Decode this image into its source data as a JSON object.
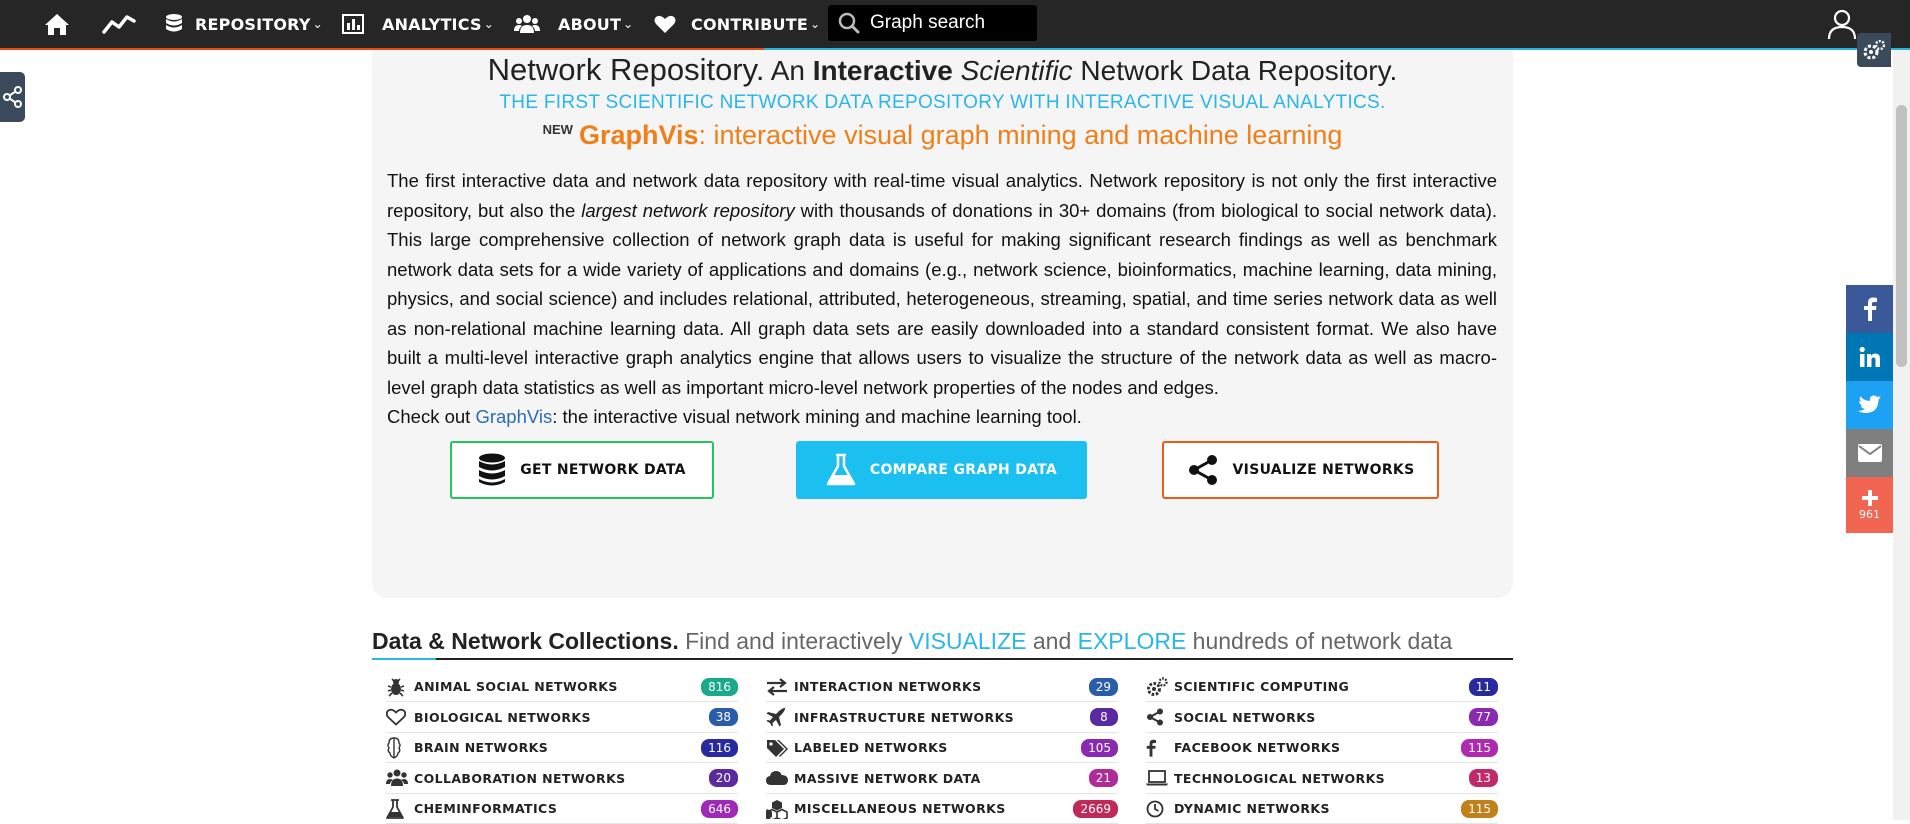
{
  "nav": {
    "repository": "REPOSITORY",
    "analytics": "ANALYTICS",
    "about": "ABOUT",
    "contribute": "CONTRIBUTE",
    "caret": "⌄",
    "search_placeholder": "Graph search"
  },
  "hero": {
    "title_a": "Network Repository.",
    "title_b": " An ",
    "title_c": "Interactive",
    "title_d": "Scientific",
    "title_e": " Network Data Repository.",
    "subtitle": "THE FIRST SCIENTIFIC NETWORK DATA REPOSITORY WITH INTERACTIVE VISUAL ANALYTICS.",
    "new_tag": "NEW",
    "graphvis": "GraphVis",
    "graphvis_rest": ": interactive visual graph mining and machine learning"
  },
  "description": {
    "p1a": "The first interactive data and network data repository with real-time visual analytics. Network repository is not only the first interactive repository, but also the ",
    "p1b": "largest network repository",
    "p1c": " with thousands of donations in 30+ domains (from biological to social network data). This large comprehensive collection of network graph data is useful for making significant research findings as well as benchmark network data sets for a wide variety of applications and domains (e.g., network science, bioinformatics, machine learning, data mining, physics, and social science) and includes relational, attributed, heterogeneous, streaming, spatial, and time series network data as well as non-relational machine learning data. All graph data sets are easily downloaded into a standard consistent format. We also have built a multi-level interactive graph analytics engine that allows users to visualize the structure of the network data as well as macro-level graph data statistics as well as important micro-level network properties of the nodes and edges.",
    "p2a": "Check out ",
    "p2link": "GraphVis",
    "p2b": ": the interactive visual network mining and machine learning tool."
  },
  "cta": {
    "get": "GET NETWORK DATA",
    "compare": "COMPARE GRAPH DATA",
    "visualize": "VISUALIZE NETWORKS"
  },
  "section": {
    "title": "Data & Network Collections.",
    "t1": " Find and interactively ",
    "visualize": "VISUALIZE",
    "and": " and ",
    "explore": "EXPLORE",
    "t2": " hundreds of network data"
  },
  "categories": {
    "col1": [
      {
        "label": "ANIMAL SOCIAL NETWORKS",
        "count": "816",
        "color": "#1aaa8a",
        "icon": "bug-icon"
      },
      {
        "label": "BIOLOGICAL NETWORKS",
        "count": "38",
        "color": "#2a5caa",
        "icon": "heart-outline-icon"
      },
      {
        "label": "BRAIN NETWORKS",
        "count": "116",
        "color": "#2a2aa0",
        "icon": "brain-icon"
      },
      {
        "label": "COLLABORATION NETWORKS",
        "count": "20",
        "color": "#5a2aa0",
        "icon": "group-icon"
      },
      {
        "label": "CHEMINFORMATICS",
        "count": "646",
        "color": "#a02ab8",
        "icon": "flask-icon"
      }
    ],
    "col2": [
      {
        "label": "INTERACTION NETWORKS",
        "count": "29",
        "color": "#2a5caa",
        "icon": "exchange-icon"
      },
      {
        "label": "INFRASTRUCTURE NETWORKS",
        "count": "8",
        "color": "#5a2aa0",
        "icon": "plane-icon"
      },
      {
        "label": "LABELED NETWORKS",
        "count": "105",
        "color": "#8a2ab0",
        "icon": "tags-icon"
      },
      {
        "label": "MASSIVE NETWORK DATA",
        "count": "21",
        "color": "#b02a9a",
        "icon": "cloud-icon"
      },
      {
        "label": "MISCELLANEOUS NETWORKS",
        "count": "2669",
        "color": "#c02a5a",
        "icon": "cubes-icon"
      }
    ],
    "col3": [
      {
        "label": "SCIENTIFIC COMPUTING",
        "count": "11",
        "color": "#2a2aa0",
        "icon": "cogs-icon"
      },
      {
        "label": "SOCIAL NETWORKS",
        "count": "77",
        "color": "#8a2ab0",
        "icon": "share-icon"
      },
      {
        "label": "FACEBOOK NETWORKS",
        "count": "115",
        "color": "#b02ab0",
        "icon": "facebook-icon"
      },
      {
        "label": "TECHNOLOGICAL NETWORKS",
        "count": "13",
        "color": "#c02a6a",
        "icon": "laptop-icon"
      },
      {
        "label": "DYNAMIC NETWORKS",
        "count": "115",
        "color": "#c0801a",
        "icon": "clock-icon"
      }
    ]
  },
  "social": {
    "share_count": "961",
    "facebook_color": "#3b5998",
    "linkedin_color": "#0077b5",
    "twitter_color": "#1da1f2",
    "email_color": "#7f7f7f",
    "more_color": "#f26552"
  }
}
